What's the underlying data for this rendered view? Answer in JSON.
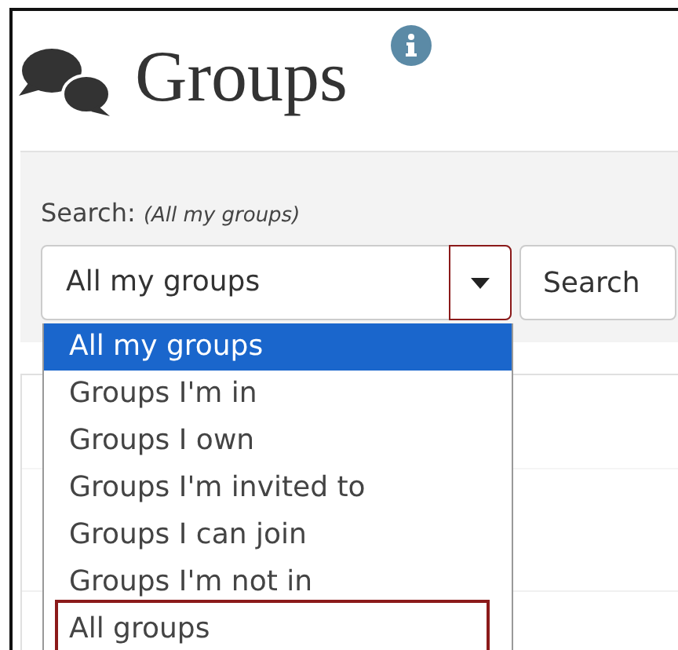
{
  "header": {
    "title": "Groups"
  },
  "search": {
    "label": "Search:",
    "scope": "(All my groups)",
    "value": "All my groups",
    "expanded": true,
    "button": "Search"
  },
  "options": [
    {
      "label": "All my groups",
      "selected": true,
      "highlighted": false
    },
    {
      "label": "Groups I'm in",
      "selected": false,
      "highlighted": false
    },
    {
      "label": "Groups I own",
      "selected": false,
      "highlighted": false
    },
    {
      "label": "Groups I'm invited to",
      "selected": false,
      "highlighted": false
    },
    {
      "label": "Groups I can join",
      "selected": false,
      "highlighted": false
    },
    {
      "label": "Groups I'm not in",
      "selected": false,
      "highlighted": false
    },
    {
      "label": "All groups",
      "selected": false,
      "highlighted": true
    }
  ]
}
